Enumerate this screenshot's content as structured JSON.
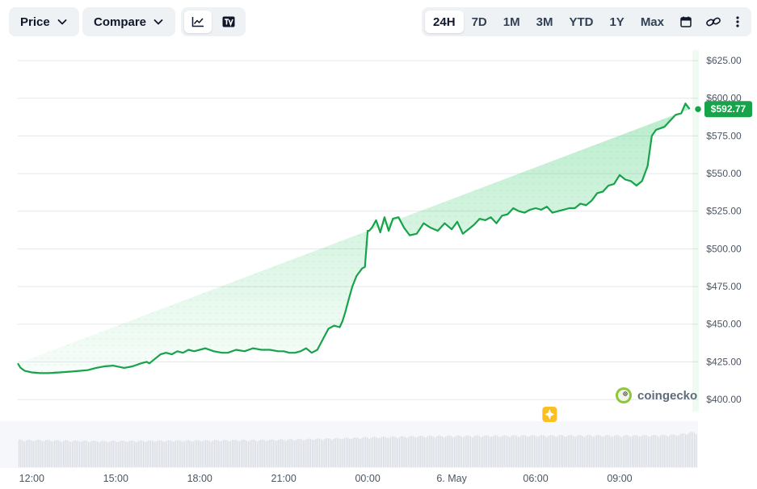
{
  "toolbar": {
    "price_label": "Price",
    "compare_label": "Compare",
    "view_icons": [
      "line-chart-icon",
      "tradingview-icon"
    ],
    "ranges": [
      "24H",
      "7D",
      "1M",
      "3M",
      "YTD",
      "1Y",
      "Max"
    ],
    "active_range": "24H",
    "extra_icons": [
      "calendar-icon",
      "link-icon",
      "more-vertical-icon"
    ]
  },
  "watermark": "coingecko",
  "colors": {
    "line": "#16a34a",
    "area": "#22c55e",
    "tag": "#16a34a",
    "grid": "#e5e7eb",
    "volume": "#d9dde3"
  },
  "chart_data": {
    "type": "area",
    "title": "",
    "xlabel": "",
    "ylabel": "",
    "y_ticks": [
      "$625.00",
      "$600.00",
      "$575.00",
      "$550.00",
      "$525.00",
      "$500.00",
      "$475.00",
      "$450.00",
      "$425.00",
      "$400.00"
    ],
    "y_tick_values": [
      625,
      600,
      575,
      550,
      525,
      500,
      475,
      450,
      425,
      400
    ],
    "ylim": [
      392,
      632
    ],
    "x_ticks": [
      "12:00",
      "15:00",
      "18:00",
      "21:00",
      "00:00",
      "6. May",
      "06:00",
      "09:00"
    ],
    "x_tick_hours": [
      12,
      15,
      18,
      21,
      24,
      27,
      30,
      33
    ],
    "xlim_hours": [
      11.5,
      35.8
    ],
    "grid": true,
    "current_price_label": "$592.77",
    "current_price": 592.77,
    "event_marker_hour": 30.5,
    "series": [
      {
        "hours": [
          11.5,
          11.6,
          11.75,
          12.0,
          12.3,
          12.6,
          13.0,
          13.4,
          13.7,
          14.0,
          14.3,
          14.6,
          14.9,
          15.3,
          15.6,
          15.9,
          16.1,
          16.2,
          16.4,
          16.6,
          16.8,
          17.0,
          17.2,
          17.4,
          17.6,
          17.8,
          18.0,
          18.2,
          18.5,
          18.8,
          19.0,
          19.3,
          19.6,
          19.9,
          20.2,
          20.5,
          20.8,
          21.0,
          21.2,
          21.4,
          21.6,
          21.8,
          22.0,
          22.2,
          22.4,
          22.6,
          22.8,
          23.0,
          23.1,
          23.2,
          23.3,
          23.45,
          23.6,
          23.8,
          23.9,
          24.0,
          24.05,
          24.15,
          24.3,
          24.45,
          24.6,
          24.75,
          24.9,
          25.1,
          25.3,
          25.5,
          25.75,
          26.0,
          26.25,
          26.5,
          26.75,
          27.0,
          27.2,
          27.4,
          27.6,
          27.8,
          28.0,
          28.2,
          28.4,
          28.6,
          28.8,
          29.0,
          29.2,
          29.4,
          29.6,
          29.8,
          30.0,
          30.2,
          30.4,
          30.6,
          30.8,
          31.0,
          31.2,
          31.4,
          31.6,
          31.8,
          32.0,
          32.2,
          32.4,
          32.6,
          32.8,
          33.0,
          33.2,
          33.4,
          33.6,
          33.8,
          34.0,
          34.15,
          34.3,
          34.45,
          34.6,
          34.8,
          35.0,
          35.2,
          35.35,
          35.5,
          35.6
        ],
        "values": [
          424,
          421,
          419,
          418,
          417.5,
          417.5,
          418,
          418.5,
          419,
          419.5,
          421,
          422,
          422.5,
          421,
          422,
          424,
          425,
          424,
          427,
          430,
          431,
          430,
          432,
          431,
          433,
          432,
          433,
          434,
          432,
          431,
          431,
          433,
          432,
          434,
          433,
          433,
          432,
          432,
          431,
          431,
          432,
          434,
          431,
          433,
          440,
          447,
          449,
          448,
          452,
          458,
          465,
          475,
          482,
          487,
          488,
          512,
          512,
          514,
          519,
          511,
          521,
          512,
          520,
          521,
          514,
          509,
          510,
          517,
          514,
          512,
          517,
          513,
          518,
          510,
          513,
          516,
          520,
          519,
          521,
          517,
          522,
          523,
          527,
          525,
          524,
          526,
          527,
          526,
          528,
          524,
          525,
          526,
          527,
          527,
          530,
          529,
          532,
          537,
          538,
          542,
          543,
          549,
          546,
          545,
          542,
          545,
          555,
          575,
          579,
          580,
          581,
          585,
          589,
          590,
          596.5,
          592.77
        ]
      }
    ],
    "volume_hours": [
      11.5,
      14.5,
      17.5,
      20.5,
      22.5,
      24.0,
      26.0,
      28.0,
      30.0,
      32.0,
      34.0,
      35.0,
      35.6
    ],
    "volume_relative": [
      0.86,
      0.82,
      0.84,
      0.86,
      0.9,
      0.94,
      0.98,
      0.99,
      1.0,
      1.0,
      1.0,
      1.02,
      1.1
    ]
  }
}
